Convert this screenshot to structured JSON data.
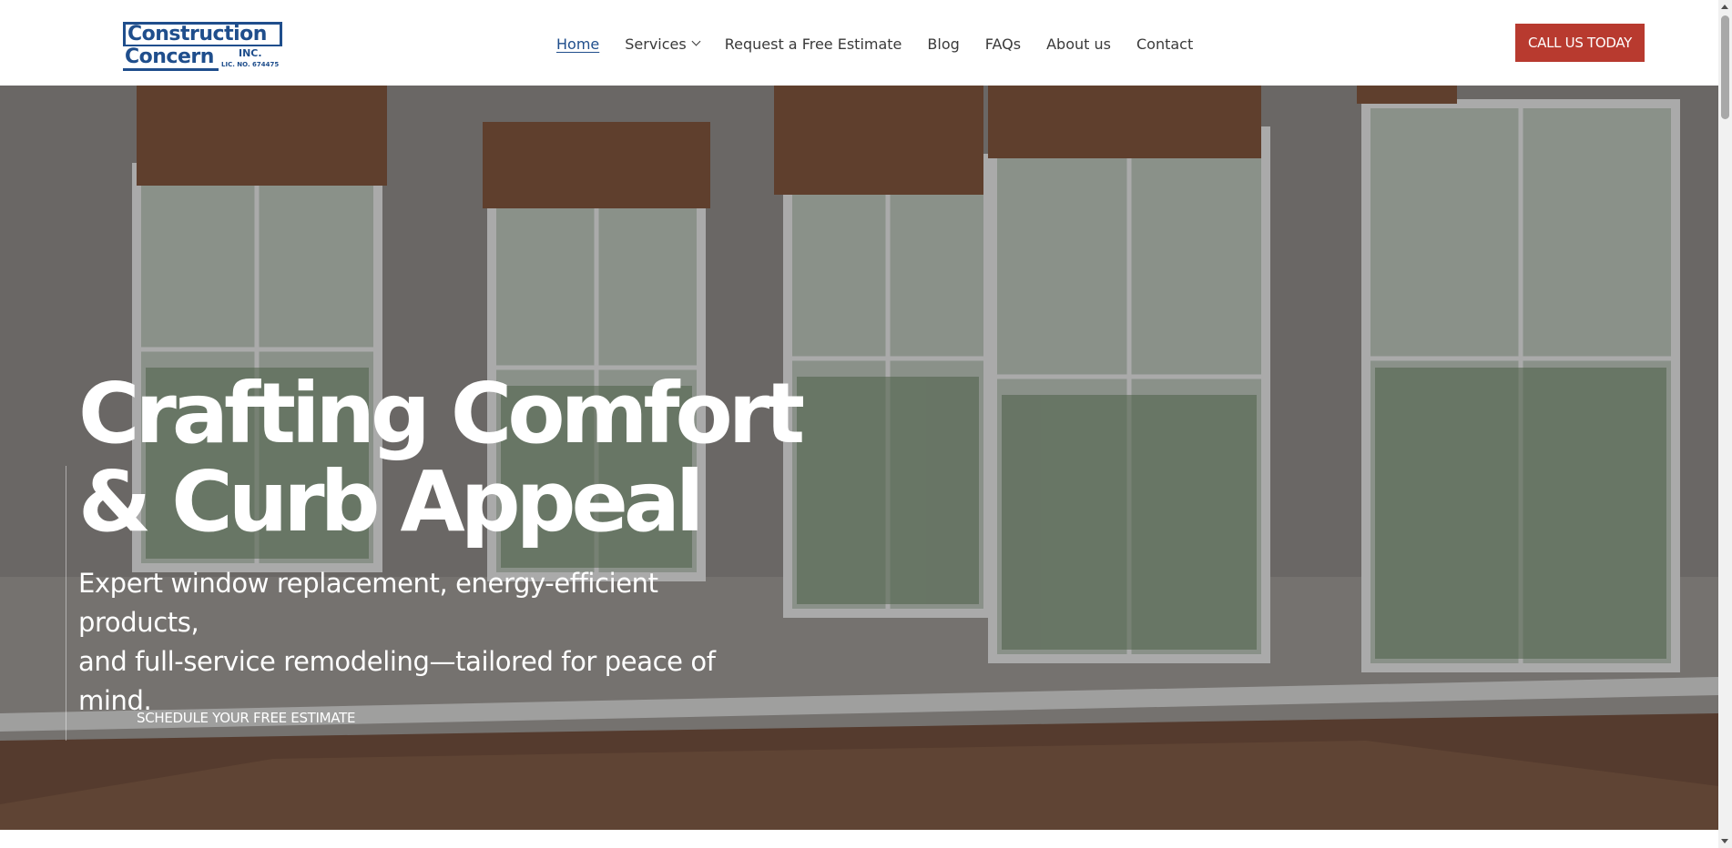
{
  "header": {
    "logo": {
      "line1": "Construction",
      "line2": "Concern",
      "inc": "INC.",
      "license": "LIC. NO. 674475"
    },
    "nav": {
      "home": "Home",
      "services": "Services",
      "estimate": "Request a Free Estimate",
      "blog": "Blog",
      "faqs": "FAQs",
      "about": "About us",
      "contact": "Contact"
    },
    "cta_label": "CALL US TODAY"
  },
  "hero": {
    "title_line1": "Crafting Comfort",
    "title_line2": "& Curb Appeal",
    "subtitle_line1": "Expert window replacement, energy-efficient products,",
    "subtitle_line2": "and full-service remodeling—tailored for peace of",
    "subtitle_line3": "mind.",
    "button_label": "SCHEDULE YOUR FREE ESTIMATE"
  },
  "colors": {
    "brand_blue": "#1f4e8c",
    "cta_red": "#b83a2f",
    "nav_text": "#3a3a3a"
  },
  "icons": {
    "services_dropdown": "chevron-down-icon"
  }
}
